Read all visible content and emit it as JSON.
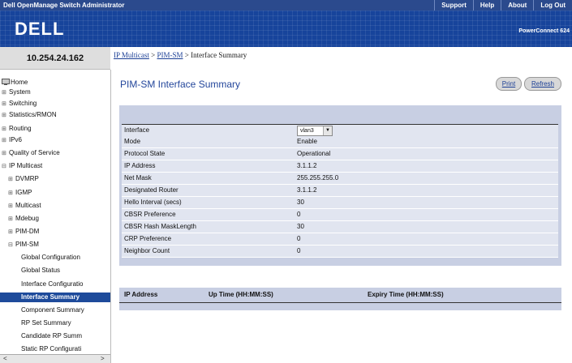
{
  "topbar": {
    "title": "Dell OpenManage Switch Administrator",
    "links": [
      "Support",
      "Help",
      "About",
      "Log Out"
    ]
  },
  "banner": {
    "logo": "DELL",
    "product": "PowerConnect 624"
  },
  "ip_address": "10.254.24.162",
  "sidebar": {
    "items": [
      {
        "label": "Home",
        "expander": "",
        "icon": "monitor-icon"
      },
      {
        "label": "System",
        "expander": "⊞"
      },
      {
        "label": "Switching",
        "expander": "⊞"
      },
      {
        "label": "Statistics/RMON",
        "expander": "⊞"
      },
      {
        "label": "Routing",
        "expander": "⊞"
      },
      {
        "label": "IPv6",
        "expander": "⊞"
      },
      {
        "label": "Quality of Service",
        "expander": "⊞"
      },
      {
        "label": "IP Multicast",
        "expander": "⊟"
      },
      {
        "label": "DVMRP",
        "expander": "⊞"
      },
      {
        "label": "IGMP",
        "expander": "⊞"
      },
      {
        "label": "Multicast",
        "expander": "⊞"
      },
      {
        "label": "Mdebug",
        "expander": "⊞"
      },
      {
        "label": "PIM-DM",
        "expander": "⊞"
      },
      {
        "label": "PIM-SM",
        "expander": "⊟"
      },
      {
        "label": "Global Configuration",
        "expander": ""
      },
      {
        "label": "Global Status",
        "expander": ""
      },
      {
        "label": "Interface Configuratio",
        "expander": ""
      },
      {
        "label": "Interface Summary",
        "expander": "",
        "selected": true
      },
      {
        "label": "Component Summary",
        "expander": ""
      },
      {
        "label": "RP Set Summary",
        "expander": ""
      },
      {
        "label": "Candidate RP Summ",
        "expander": ""
      },
      {
        "label": "Static RP Configurati",
        "expander": ""
      }
    ],
    "scroll_left": "<",
    "scroll_right": ">"
  },
  "breadcrumb": {
    "link1": "IP Multicast",
    "sep1": " > ",
    "link2": "PIM-SM",
    "sep2": " > ",
    "current": "Interface Summary"
  },
  "page_title": "PIM-SM Interface Summary",
  "buttons": {
    "print": "Print",
    "refresh": "Refresh"
  },
  "form": {
    "interface_label": "Interface",
    "interface_value": "vlan3",
    "rows": [
      {
        "label": "Mode",
        "value": "Enable"
      },
      {
        "label": "Protocol State",
        "value": "Operational"
      },
      {
        "label": "IP Address",
        "value": "3.1.1.2"
      },
      {
        "label": "Net Mask",
        "value": "255.255.255.0"
      },
      {
        "label": "Designated Router",
        "value": "3.1.1.2"
      },
      {
        "label": "Hello Interval (secs)",
        "value": "30"
      },
      {
        "label": "CBSR Preference",
        "value": "0"
      },
      {
        "label": "CBSR Hash MaskLength",
        "value": "30"
      },
      {
        "label": "CRP Preference",
        "value": "0"
      },
      {
        "label": "Neighbor Count",
        "value": "0"
      }
    ]
  },
  "neighbor_table": {
    "headers": [
      "IP Address",
      "Up Time (HH:MM:SS)",
      "Expiry Time (HH:MM:SS)"
    ]
  },
  "colors": {
    "accent": "#23469b",
    "panel": "#c8cfe3",
    "row": "#e1e5f0",
    "selected": "#1e4b9b"
  }
}
